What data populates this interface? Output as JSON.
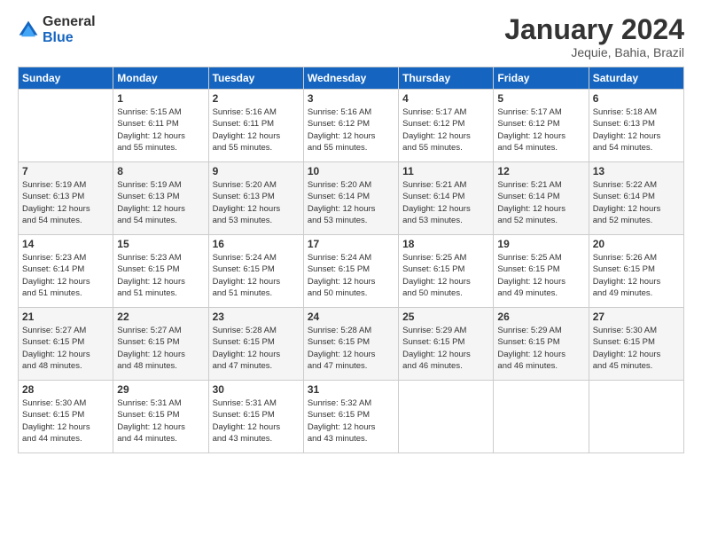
{
  "logo": {
    "general": "General",
    "blue": "Blue"
  },
  "title": "January 2024",
  "subtitle": "Jequie, Bahia, Brazil",
  "days_header": [
    "Sunday",
    "Monday",
    "Tuesday",
    "Wednesday",
    "Thursday",
    "Friday",
    "Saturday"
  ],
  "weeks": [
    [
      {
        "day": "",
        "info": ""
      },
      {
        "day": "1",
        "info": "Sunrise: 5:15 AM\nSunset: 6:11 PM\nDaylight: 12 hours\nand 55 minutes."
      },
      {
        "day": "2",
        "info": "Sunrise: 5:16 AM\nSunset: 6:11 PM\nDaylight: 12 hours\nand 55 minutes."
      },
      {
        "day": "3",
        "info": "Sunrise: 5:16 AM\nSunset: 6:12 PM\nDaylight: 12 hours\nand 55 minutes."
      },
      {
        "day": "4",
        "info": "Sunrise: 5:17 AM\nSunset: 6:12 PM\nDaylight: 12 hours\nand 55 minutes."
      },
      {
        "day": "5",
        "info": "Sunrise: 5:17 AM\nSunset: 6:12 PM\nDaylight: 12 hours\nand 54 minutes."
      },
      {
        "day": "6",
        "info": "Sunrise: 5:18 AM\nSunset: 6:13 PM\nDaylight: 12 hours\nand 54 minutes."
      }
    ],
    [
      {
        "day": "7",
        "info": "Sunrise: 5:19 AM\nSunset: 6:13 PM\nDaylight: 12 hours\nand 54 minutes."
      },
      {
        "day": "8",
        "info": "Sunrise: 5:19 AM\nSunset: 6:13 PM\nDaylight: 12 hours\nand 54 minutes."
      },
      {
        "day": "9",
        "info": "Sunrise: 5:20 AM\nSunset: 6:13 PM\nDaylight: 12 hours\nand 53 minutes."
      },
      {
        "day": "10",
        "info": "Sunrise: 5:20 AM\nSunset: 6:14 PM\nDaylight: 12 hours\nand 53 minutes."
      },
      {
        "day": "11",
        "info": "Sunrise: 5:21 AM\nSunset: 6:14 PM\nDaylight: 12 hours\nand 53 minutes."
      },
      {
        "day": "12",
        "info": "Sunrise: 5:21 AM\nSunset: 6:14 PM\nDaylight: 12 hours\nand 52 minutes."
      },
      {
        "day": "13",
        "info": "Sunrise: 5:22 AM\nSunset: 6:14 PM\nDaylight: 12 hours\nand 52 minutes."
      }
    ],
    [
      {
        "day": "14",
        "info": "Sunrise: 5:23 AM\nSunset: 6:14 PM\nDaylight: 12 hours\nand 51 minutes."
      },
      {
        "day": "15",
        "info": "Sunrise: 5:23 AM\nSunset: 6:15 PM\nDaylight: 12 hours\nand 51 minutes."
      },
      {
        "day": "16",
        "info": "Sunrise: 5:24 AM\nSunset: 6:15 PM\nDaylight: 12 hours\nand 51 minutes."
      },
      {
        "day": "17",
        "info": "Sunrise: 5:24 AM\nSunset: 6:15 PM\nDaylight: 12 hours\nand 50 minutes."
      },
      {
        "day": "18",
        "info": "Sunrise: 5:25 AM\nSunset: 6:15 PM\nDaylight: 12 hours\nand 50 minutes."
      },
      {
        "day": "19",
        "info": "Sunrise: 5:25 AM\nSunset: 6:15 PM\nDaylight: 12 hours\nand 49 minutes."
      },
      {
        "day": "20",
        "info": "Sunrise: 5:26 AM\nSunset: 6:15 PM\nDaylight: 12 hours\nand 49 minutes."
      }
    ],
    [
      {
        "day": "21",
        "info": "Sunrise: 5:27 AM\nSunset: 6:15 PM\nDaylight: 12 hours\nand 48 minutes."
      },
      {
        "day": "22",
        "info": "Sunrise: 5:27 AM\nSunset: 6:15 PM\nDaylight: 12 hours\nand 48 minutes."
      },
      {
        "day": "23",
        "info": "Sunrise: 5:28 AM\nSunset: 6:15 PM\nDaylight: 12 hours\nand 47 minutes."
      },
      {
        "day": "24",
        "info": "Sunrise: 5:28 AM\nSunset: 6:15 PM\nDaylight: 12 hours\nand 47 minutes."
      },
      {
        "day": "25",
        "info": "Sunrise: 5:29 AM\nSunset: 6:15 PM\nDaylight: 12 hours\nand 46 minutes."
      },
      {
        "day": "26",
        "info": "Sunrise: 5:29 AM\nSunset: 6:15 PM\nDaylight: 12 hours\nand 46 minutes."
      },
      {
        "day": "27",
        "info": "Sunrise: 5:30 AM\nSunset: 6:15 PM\nDaylight: 12 hours\nand 45 minutes."
      }
    ],
    [
      {
        "day": "28",
        "info": "Sunrise: 5:30 AM\nSunset: 6:15 PM\nDaylight: 12 hours\nand 44 minutes."
      },
      {
        "day": "29",
        "info": "Sunrise: 5:31 AM\nSunset: 6:15 PM\nDaylight: 12 hours\nand 44 minutes."
      },
      {
        "day": "30",
        "info": "Sunrise: 5:31 AM\nSunset: 6:15 PM\nDaylight: 12 hours\nand 43 minutes."
      },
      {
        "day": "31",
        "info": "Sunrise: 5:32 AM\nSunset: 6:15 PM\nDaylight: 12 hours\nand 43 minutes."
      },
      {
        "day": "",
        "info": ""
      },
      {
        "day": "",
        "info": ""
      },
      {
        "day": "",
        "info": ""
      }
    ]
  ]
}
